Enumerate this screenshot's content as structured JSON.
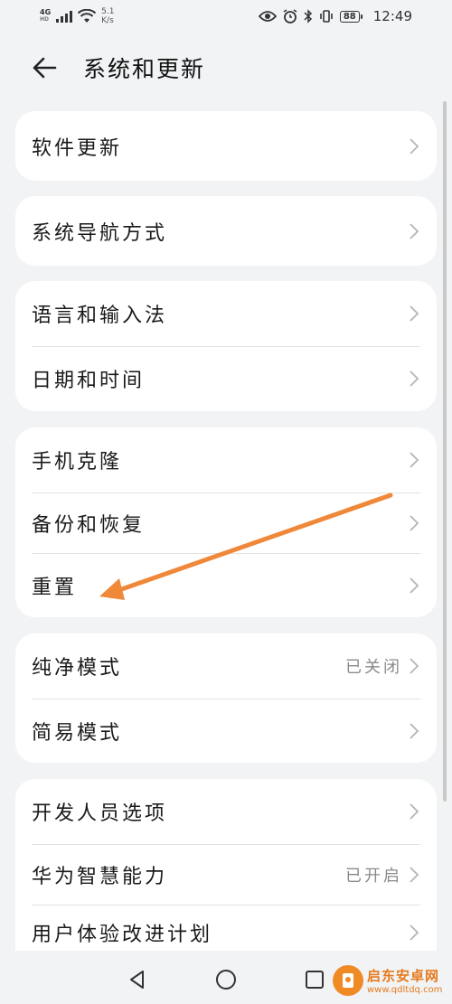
{
  "status_bar": {
    "network_type_top": "4G",
    "network_type_bottom": "HD",
    "speed_value": "5.1",
    "speed_unit": "K/s",
    "battery": "88",
    "time": "12:49"
  },
  "header": {
    "title": "系统和更新"
  },
  "groups": [
    {
      "items": [
        {
          "label": "软件更新",
          "value": ""
        }
      ]
    },
    {
      "items": [
        {
          "label": "系统导航方式",
          "value": ""
        }
      ]
    },
    {
      "items": [
        {
          "label": "语言和输入法",
          "value": ""
        },
        {
          "label": "日期和时间",
          "value": ""
        }
      ]
    },
    {
      "items": [
        {
          "label": "手机克隆",
          "value": ""
        },
        {
          "label": "备份和恢复",
          "value": ""
        },
        {
          "label": "重置",
          "value": ""
        }
      ]
    },
    {
      "items": [
        {
          "label": "纯净模式",
          "value": "已关闭"
        },
        {
          "label": "简易模式",
          "value": ""
        }
      ]
    },
    {
      "items": [
        {
          "label": "开发人员选项",
          "value": ""
        },
        {
          "label": "华为智慧能力",
          "value": "已开启"
        },
        {
          "label": "用户体验改进计划",
          "value": ""
        }
      ]
    }
  ],
  "annotation": {
    "arrow_color": "#f0883a"
  },
  "watermark": {
    "name": "启东安卓网",
    "url": "www.qdltdq.com"
  },
  "icons": {
    "back": "back-arrow-icon",
    "chevron": "chevron-right-icon",
    "nav_back": "triangle-back-icon",
    "nav_home": "circle-home-icon",
    "nav_recent": "square-recent-icon"
  }
}
